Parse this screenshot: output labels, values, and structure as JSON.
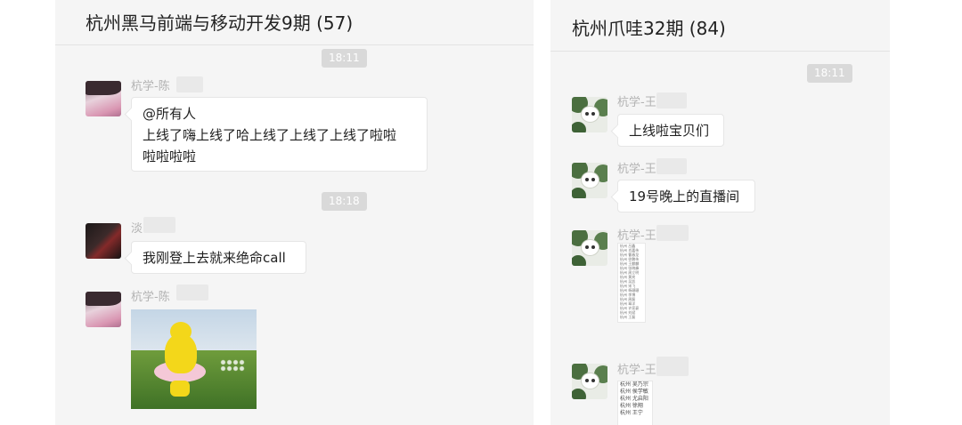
{
  "left_chat": {
    "title": "杭州黑马前端与移动开发9期 (57)",
    "messages": [
      {
        "time": "18:11"
      },
      {
        "sender": "杭学-陈",
        "lines": [
          "@所有人",
          "上线了嗨上线了哈上线了上线了上线了啦啦",
          "啦啦啦啦"
        ]
      },
      {
        "time": "18:18"
      },
      {
        "sender": "淡",
        "lines": [
          "我刚登上去就来绝命call"
        ]
      },
      {
        "sender": "杭学-陈",
        "image": "teletubby-dancing-image"
      }
    ]
  },
  "right_chat": {
    "title": "杭州爪哇32期 (84)",
    "messages": [
      {
        "time": "18:11"
      },
      {
        "sender": "杭学-王",
        "lines": [
          "上线啦宝贝们"
        ]
      },
      {
        "sender": "杭学-王",
        "lines": [
          "19号晚上的直播间"
        ]
      },
      {
        "sender": "杭学-王",
        "image": "name-list-image"
      },
      {
        "sender": "杭学-王",
        "image": "name-list-image",
        "list_rows": [
          "杭州 吴乃宗",
          "杭州 侯学敏",
          "杭州 尤启阳",
          "杭州 徐翔",
          "杭州 王宁"
        ]
      }
    ]
  }
}
